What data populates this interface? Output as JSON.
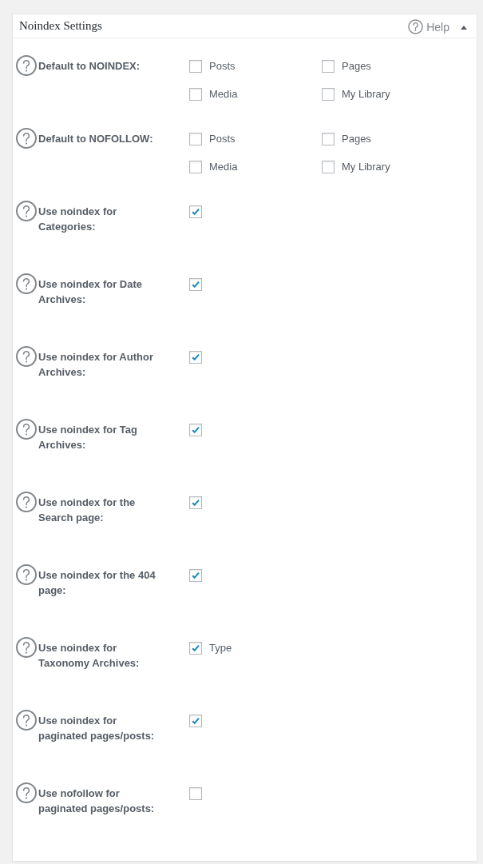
{
  "panel": {
    "title": "Noindex Settings",
    "help_label": "Help",
    "expanded": true
  },
  "settings": [
    {
      "label": "Default to NOINDEX:",
      "options": [
        {
          "label": "Posts",
          "checked": false
        },
        {
          "label": "Pages",
          "checked": false
        },
        {
          "label": "Media",
          "checked": false
        },
        {
          "label": "My Library",
          "checked": false
        }
      ]
    },
    {
      "label": "Default to NOFOLLOW:",
      "options": [
        {
          "label": "Posts",
          "checked": false
        },
        {
          "label": "Pages",
          "checked": false
        },
        {
          "label": "Media",
          "checked": false
        },
        {
          "label": "My Library",
          "checked": false
        }
      ]
    },
    {
      "label": "Use noindex for Categories:",
      "options": [
        {
          "checked": true
        }
      ]
    },
    {
      "label": "Use noindex for Date Archives:",
      "options": [
        {
          "checked": true
        }
      ]
    },
    {
      "label": "Use noindex for Author Archives:",
      "options": [
        {
          "checked": true
        }
      ]
    },
    {
      "label": "Use noindex for Tag Archives:",
      "options": [
        {
          "checked": true
        }
      ]
    },
    {
      "label": "Use noindex for the Search page:",
      "options": [
        {
          "checked": true
        }
      ]
    },
    {
      "label": "Use noindex for the 404 page:",
      "options": [
        {
          "checked": true
        }
      ]
    },
    {
      "label": "Use noindex for Taxonomy Archives:",
      "options": [
        {
          "label": "Type",
          "checked": true
        }
      ]
    },
    {
      "label": "Use noindex for paginated pages/posts:",
      "options": [
        {
          "checked": true
        }
      ]
    },
    {
      "label": "Use nofollow for paginated pages/posts:",
      "options": [
        {
          "checked": false
        }
      ]
    }
  ]
}
